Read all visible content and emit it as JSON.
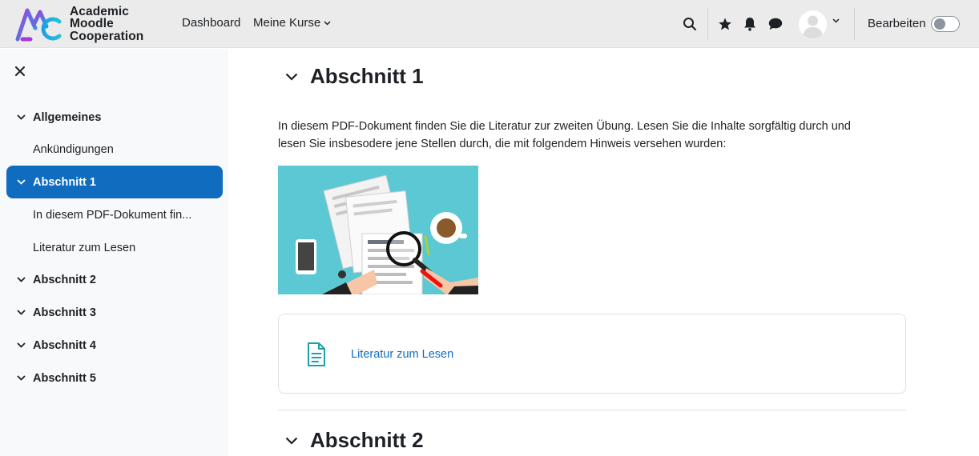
{
  "brand": {
    "line1": "Academic",
    "line2": "Moodle",
    "line3": "Cooperation",
    "colors": {
      "blue": "#1fa0e6",
      "magenta": "#a93ad8",
      "teal": "#26c0d6"
    }
  },
  "nav": {
    "dashboard": "Dashboard",
    "courses": "Meine Kurse",
    "edit_label": "Bearbeiten",
    "icons": [
      "search-icon",
      "star-icon",
      "bell-icon",
      "chat-icon",
      "avatar",
      "chevron-down-icon"
    ]
  },
  "sidebar": {
    "close_icon": "close-icon",
    "items": [
      {
        "label": "Allgemeines",
        "type": "section"
      },
      {
        "label": "Ankündigungen",
        "type": "child"
      },
      {
        "label": "Abschnitt 1",
        "type": "section",
        "active": true
      },
      {
        "label": "In diesem PDF-Dokument fin...",
        "type": "child"
      },
      {
        "label": "Literatur zum Lesen",
        "type": "child"
      },
      {
        "label": "Abschnitt 2",
        "type": "section"
      },
      {
        "label": "Abschnitt 3",
        "type": "section"
      },
      {
        "label": "Abschnitt 4",
        "type": "section"
      },
      {
        "label": "Abschnitt 5",
        "type": "section"
      }
    ],
    "active_color": "#0f6cbf"
  },
  "main": {
    "section1_title": "Abschnitt 1",
    "summary_line1": "In diesem PDF-Dokument finden Sie die Literatur zur zweiten Übung. Lesen Sie die Inhalte sorgfältig durch und",
    "summary_line2": "lesen Sie insbesodere jene Stellen durch, die mit folgendem Hinweis versehen wurden:",
    "activity_label": "Literatur zum Lesen",
    "activity_icon": "document-icon",
    "section2_title": "Abschnitt 2",
    "link_color": "#0f6cbf"
  }
}
